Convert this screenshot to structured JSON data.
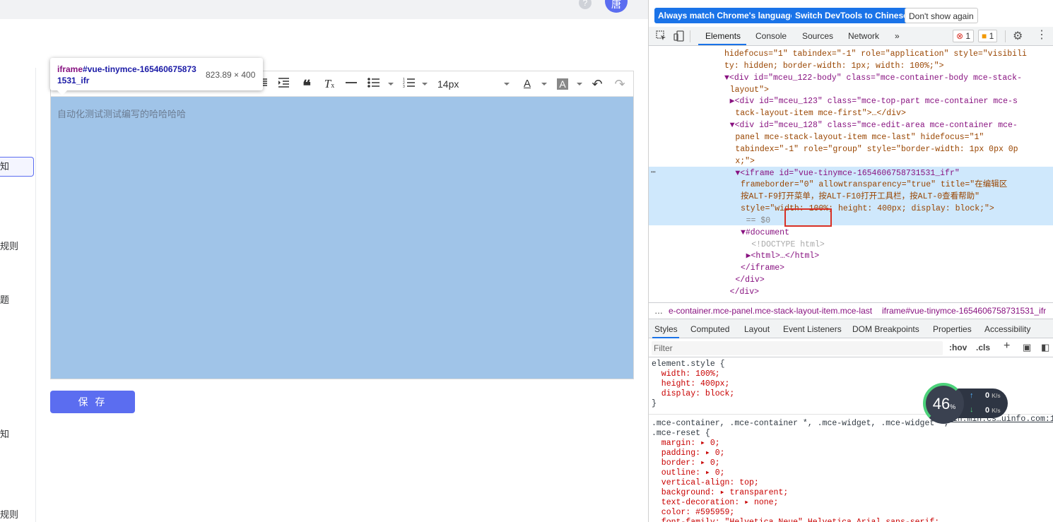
{
  "app": {
    "avatar_text": "唐",
    "help_icon_text": "?",
    "sidebar_items": [
      "知",
      "规则",
      "题",
      "知",
      "规则"
    ],
    "editor": {
      "font_size": "14px",
      "content_text": "自动化测试测试编写的哈哈哈哈"
    },
    "tooltip": {
      "tag": "iframe",
      "id": "#vue-tinymce-1654606758731531_ifr",
      "size": "823.89 × 400"
    },
    "save_label": "保 存",
    "accent_color": "#5b6df0",
    "selection_color": "#a0c4e8"
  },
  "devtools": {
    "infobar": {
      "btn_match": "Always match Chrome's language",
      "btn_switch": "Switch DevTools to Chinese",
      "btn_dont": "Don't show again"
    },
    "tabs": [
      "Elements",
      "Console",
      "Sources",
      "Network",
      "»"
    ],
    "error_count": "1",
    "warn_count": "1",
    "dom_lines": [
      {
        "indent": 14,
        "text": "hidefocus=\"1\" tabindex=\"-1\" role=\"application\" style=\"visibili"
      },
      {
        "indent": 14,
        "text": "ty: hidden; border-width: 1px; width: 100%;\">"
      },
      {
        "indent": 14,
        "text": "▼<div id=\"mceu_122-body\" class=\"mce-container-body mce-stack-"
      },
      {
        "indent": 15,
        "text": "layout\">"
      },
      {
        "indent": 15,
        "text": "▶<div id=\"mceu_123\" class=\"mce-top-part mce-container mce-s"
      },
      {
        "indent": 16,
        "text": "tack-layout-item mce-first\">…</div>"
      },
      {
        "indent": 15,
        "text": "▼<div id=\"mceu_128\" class=\"mce-edit-area mce-container mce-"
      },
      {
        "indent": 16,
        "text": "panel mce-stack-layout-item mce-last\" hidefocus=\"1\""
      },
      {
        "indent": 16,
        "text": "tabindex=\"-1\" role=\"group\" style=\"border-width: 1px 0px 0p"
      },
      {
        "indent": 16,
        "text": "x;\">"
      },
      {
        "indent": 16,
        "text": "▼<iframe id=\"vue-tinymce-1654606758731531_ifr\""
      },
      {
        "indent": 17,
        "text": "frameborder=\"0\" allowtransparency=\"true\" title=\"在编辑区"
      },
      {
        "indent": 17,
        "text": "按ALT-F9打开菜单，按ALT-F10打开工具栏，按ALT-0查看帮助\""
      },
      {
        "indent": 17,
        "text": "style=\"width: 100%; height: 400px; display: block;\">"
      },
      {
        "indent": 18,
        "text": "== $0"
      },
      {
        "indent": 17,
        "text": "▼#document"
      },
      {
        "indent": 19,
        "text": "<!DOCTYPE html>"
      },
      {
        "indent": 18,
        "text": "▶<html>…</html>"
      },
      {
        "indent": 17,
        "text": "</iframe>"
      },
      {
        "indent": 16,
        "text": "</div>"
      },
      {
        "indent": 15,
        "text": "</div>"
      }
    ],
    "breadcrumb_ellipsis": "…",
    "breadcrumb_1": "e-container.mce-panel.mce-stack-layout-item.mce-last",
    "breadcrumb_2": "iframe#vue-tinymce-1654606758731531_ifr",
    "subtabs": [
      "Styles",
      "Computed",
      "Layout",
      "Event Listeners",
      "DOM Breakpoints",
      "Properties",
      "Accessibility"
    ],
    "filter_placeholder": "Filter",
    "hov": ":hov",
    "cls": ".cls",
    "styles_lines": [
      "element.style {",
      "  width: 100%;",
      "  height: 400px;",
      "  display: block;",
      "}",
      ".mce-container, .mce-container *, .mce-widget, .mce-widget *,",
      ".mce-reset {",
      "  margin: ▸ 0;",
      "  padding: ▸ 0;",
      "  border: ▸ 0;",
      "  outline: ▸ 0;",
      "  vertical-align: top;",
      "  background: ▸ transparent;",
      "  text-decoration: ▸ none;",
      "  color: #595959;",
      "  font-family: \"Helvetica Neue\",Helvetica,Arial,sans-serif;"
    ],
    "style_source": "skin.min.cs…uinfo.com:1",
    "net_widget": {
      "percent": "46",
      "percent_unit": "%",
      "up": "0",
      "down": "0",
      "unit": "K/s"
    }
  }
}
